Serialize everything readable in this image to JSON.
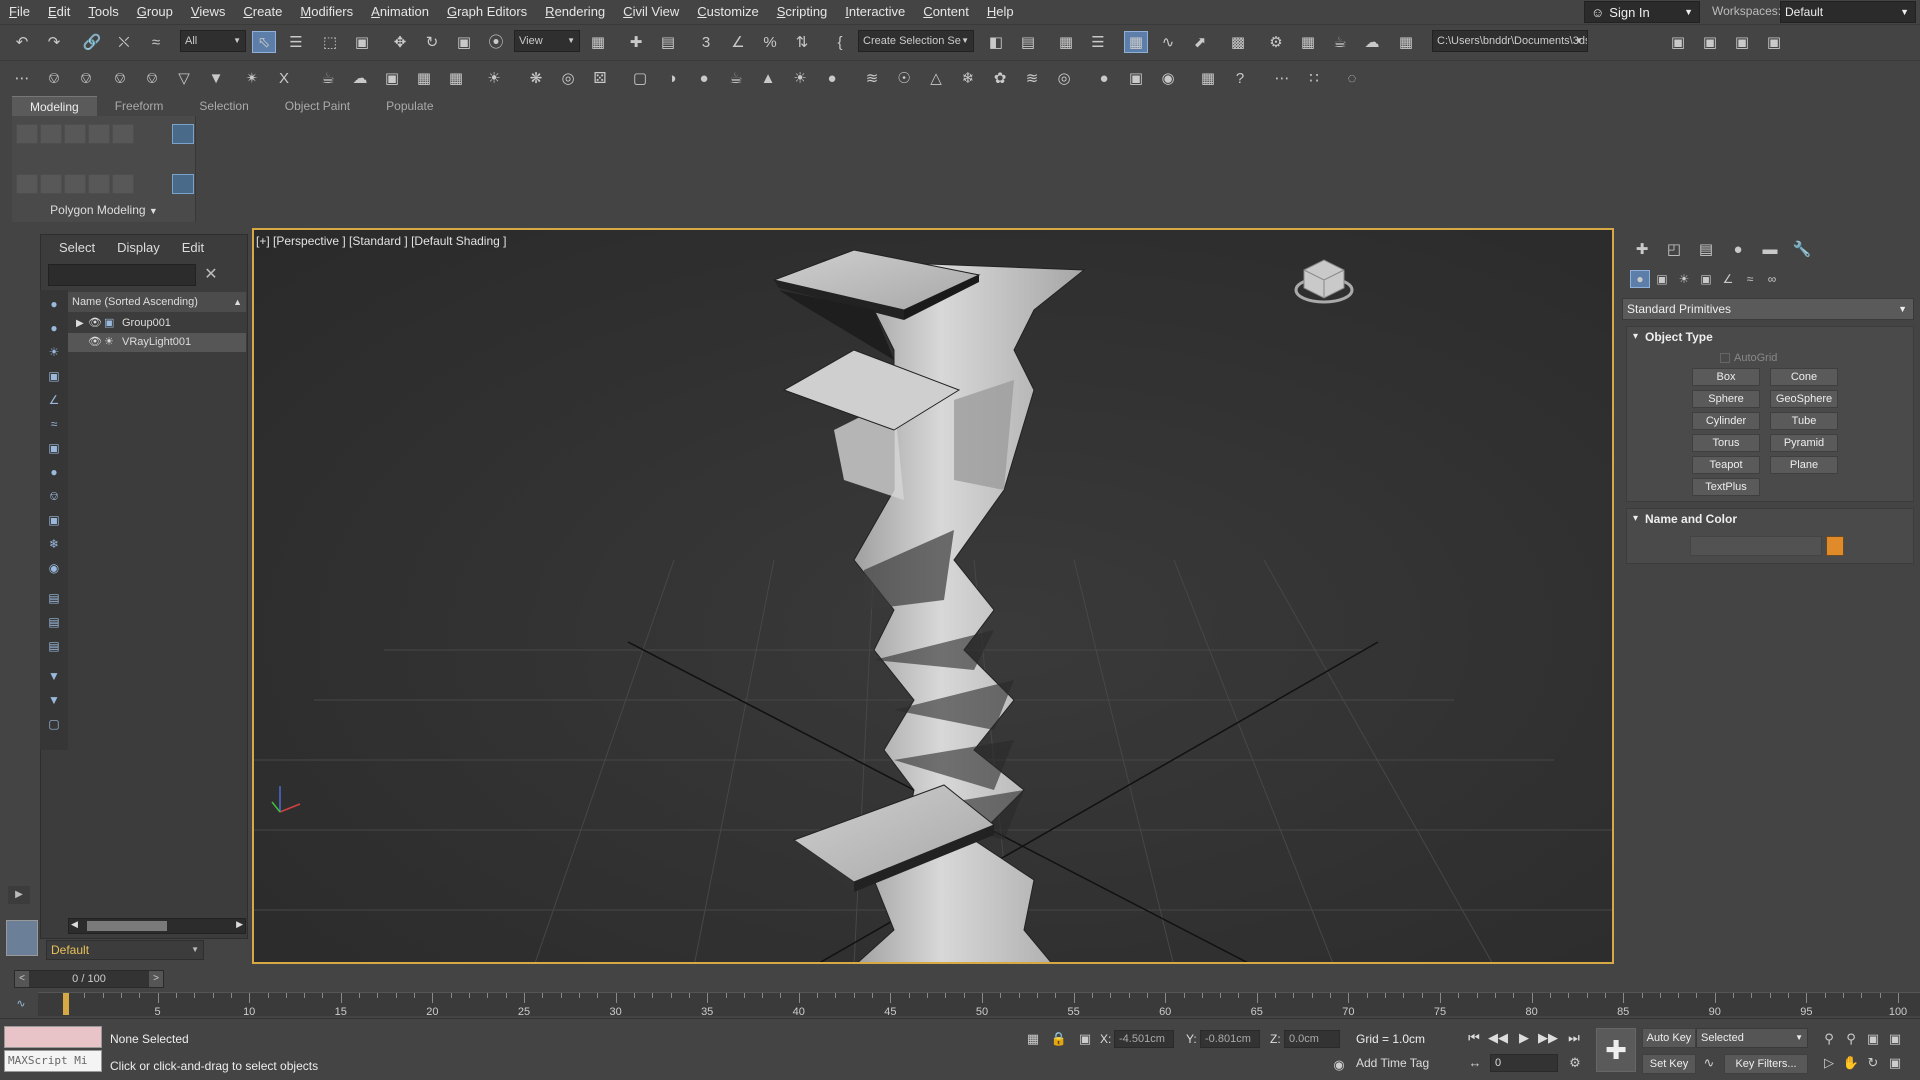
{
  "menu": [
    "File",
    "Edit",
    "Tools",
    "Group",
    "Views",
    "Create",
    "Modifiers",
    "Animation",
    "Graph Editors",
    "Rendering",
    "Civil View",
    "Customize",
    "Scripting",
    "Interactive",
    "Content",
    "Help"
  ],
  "sign_in": "Sign In",
  "workspaces": {
    "label": "Workspaces:",
    "value": "Default"
  },
  "toolbar": {
    "filter": "All",
    "ref_coord": "View",
    "selection_set": "Create Selection Se",
    "path": "C:\\Users\\bnddr\\Documents\\3ds Max 2020"
  },
  "ribbon": {
    "tabs": [
      "Modeling",
      "Freeform",
      "Selection",
      "Object Paint",
      "Populate"
    ],
    "active_tab": "Modeling",
    "panel_label": "Polygon Modeling"
  },
  "scene_explorer": {
    "menus": [
      "Select",
      "Display",
      "Edit"
    ],
    "column_header": "Name (Sorted Ascending)",
    "items": [
      {
        "name": "Group001"
      },
      {
        "name": "VRayLight001"
      }
    ]
  },
  "layer": "Default",
  "viewport": {
    "label": "[+] [Perspective ] [Standard ] [Default Shading ]"
  },
  "command_panel": {
    "category": "Standard Primitives",
    "object_type_title": "Object Type",
    "autogrid": "AutoGrid",
    "primitives": [
      "Box",
      "Cone",
      "Sphere",
      "GeoSphere",
      "Cylinder",
      "Tube",
      "Torus",
      "Pyramid",
      "Teapot",
      "Plane",
      "TextPlus"
    ],
    "name_color_title": "Name and Color",
    "color": "#e08a2a"
  },
  "timeline": {
    "slider": "0 / 100",
    "ticks": [
      "5",
      "10",
      "15",
      "20",
      "25",
      "30",
      "35",
      "40",
      "45",
      "50",
      "55",
      "60",
      "65",
      "70",
      "75",
      "80",
      "85",
      "90",
      "95",
      "100"
    ]
  },
  "status": {
    "maxscript": "MAXScript Mi",
    "selection": "None Selected",
    "hint": "Click or click-and-drag to select objects",
    "x_label": "X:",
    "x": "-4.501cm",
    "y_label": "Y:",
    "y": "-0.801cm",
    "z_label": "Z:",
    "z": "0.0cm",
    "grid": "Grid = 1.0cm",
    "add_time_tag": "Add Time Tag",
    "frame": "0",
    "auto_key": "Auto Key",
    "set_key": "Set Key",
    "key_mode": "Selected",
    "key_filters": "Key Filters..."
  }
}
